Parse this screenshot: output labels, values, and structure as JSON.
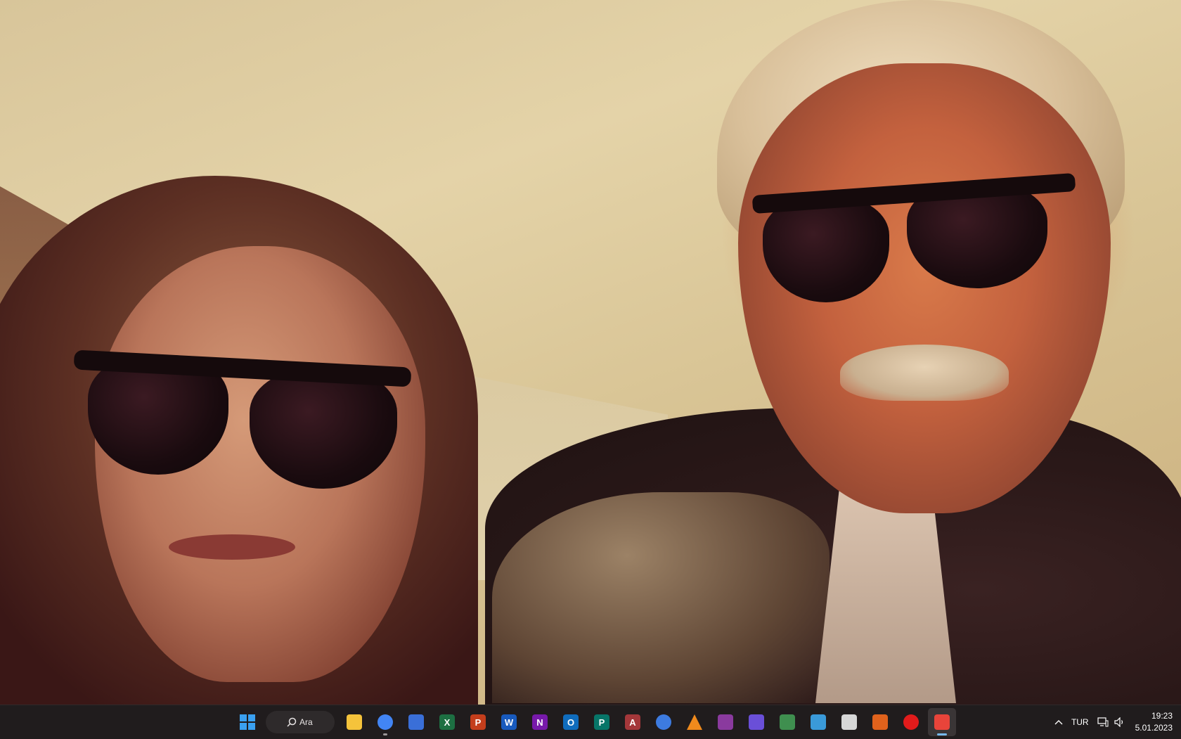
{
  "desktop": {
    "wallpaper": "photo of two people wearing dark sunglasses"
  },
  "taskbar": {
    "search_label": "Ara",
    "apps": [
      {
        "name": "file-explorer",
        "glyph": "",
        "color": "#f5c33b",
        "running": false,
        "active": false
      },
      {
        "name": "chrome",
        "glyph": "",
        "color": "#4285f4",
        "running": true,
        "active": false
      },
      {
        "name": "microsoft-store",
        "glyph": "",
        "color": "#3a6fd8",
        "running": false,
        "active": false
      },
      {
        "name": "excel",
        "glyph": "X",
        "color": "#1d6f42",
        "running": false,
        "active": false
      },
      {
        "name": "powerpoint",
        "glyph": "P",
        "color": "#c43e1c",
        "running": false,
        "active": false
      },
      {
        "name": "word",
        "glyph": "W",
        "color": "#185abd",
        "running": false,
        "active": false
      },
      {
        "name": "onenote",
        "glyph": "N",
        "color": "#7719aa",
        "running": false,
        "active": false
      },
      {
        "name": "outlook",
        "glyph": "O",
        "color": "#0f6cbd",
        "running": false,
        "active": false
      },
      {
        "name": "publisher",
        "glyph": "P",
        "color": "#077568",
        "running": false,
        "active": false
      },
      {
        "name": "access",
        "glyph": "A",
        "color": "#a4373a",
        "running": false,
        "active": false
      },
      {
        "name": "app-blue-circle",
        "glyph": "",
        "color": "#3d7be0",
        "running": false,
        "active": false
      },
      {
        "name": "vlc",
        "glyph": "",
        "color": "#f08a1c",
        "running": false,
        "active": false
      },
      {
        "name": "winrar",
        "glyph": "",
        "color": "#8a3a9e",
        "running": false,
        "active": false
      },
      {
        "name": "app-purple-chip",
        "glyph": "",
        "color": "#6a4fd8",
        "running": false,
        "active": false
      },
      {
        "name": "photos",
        "glyph": "",
        "color": "#3f8f4f",
        "running": false,
        "active": false
      },
      {
        "name": "app-screen",
        "glyph": "",
        "color": "#3a9ad9",
        "running": false,
        "active": false
      },
      {
        "name": "app-notes",
        "glyph": "",
        "color": "#d7d7d7",
        "running": false,
        "active": false
      },
      {
        "name": "app-orange-blue",
        "glyph": "",
        "color": "#e0621c",
        "running": false,
        "active": false
      },
      {
        "name": "screen-recorder",
        "glyph": "",
        "color": "#e21b1b",
        "running": false,
        "active": false
      },
      {
        "name": "snipping-tool",
        "glyph": "",
        "color": "#e8443a",
        "running": true,
        "active": true
      }
    ],
    "tray": {
      "language": "TUR",
      "time": "19:23",
      "date": "5.01.2023"
    }
  }
}
